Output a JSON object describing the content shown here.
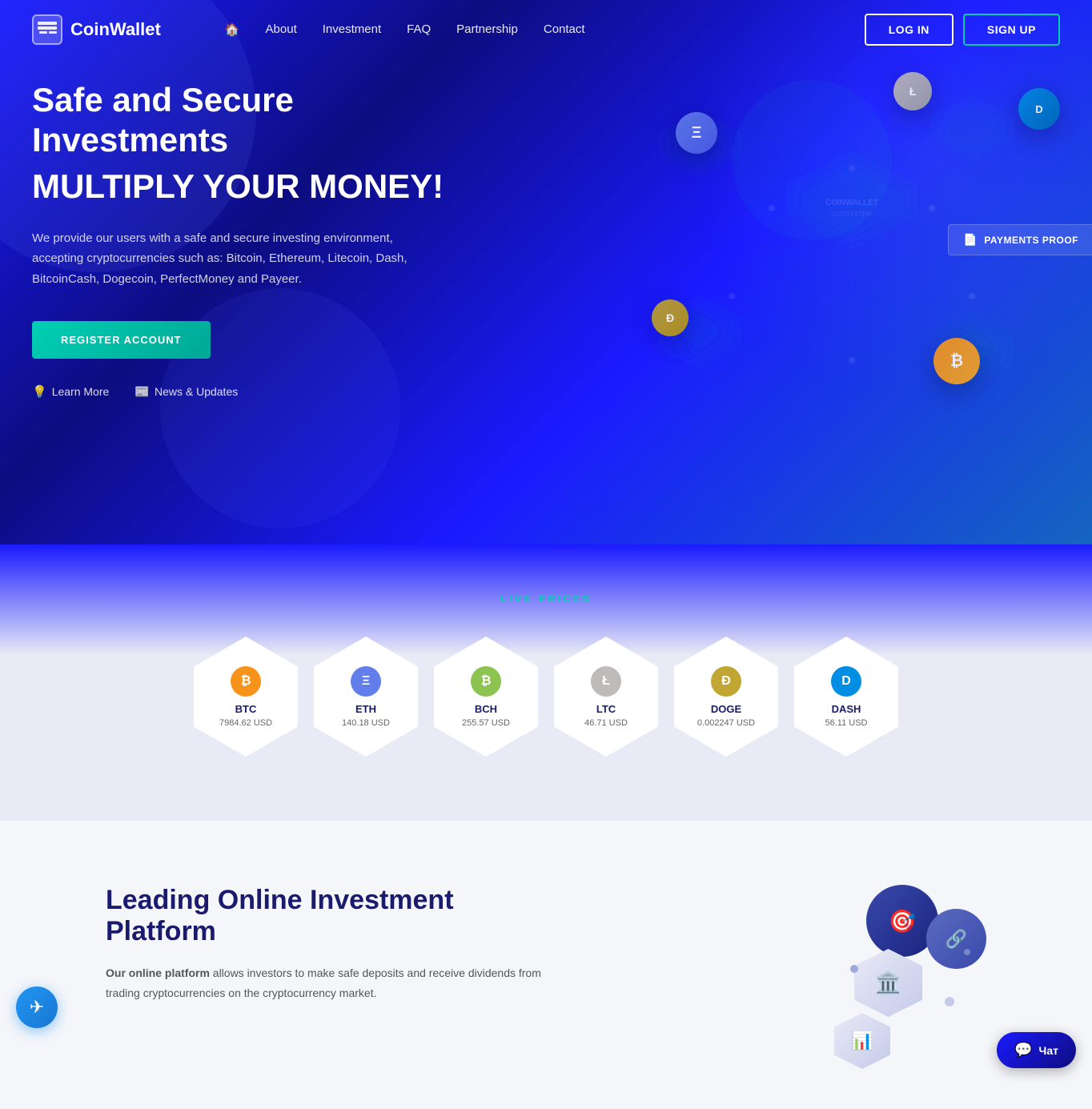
{
  "brand": {
    "name": "CoinWallet",
    "logo_icon": "💳"
  },
  "nav": {
    "home_icon": "🏠",
    "links": [
      {
        "label": "About",
        "href": "#about"
      },
      {
        "label": "Investment",
        "href": "#investment"
      },
      {
        "label": "FAQ",
        "href": "#faq"
      },
      {
        "label": "Partnership",
        "href": "#partnership"
      },
      {
        "label": "Contact",
        "href": "#contact"
      }
    ],
    "login_label": "LOG IN",
    "signup_label": "SIGN UP"
  },
  "hero": {
    "title_line1": "Safe and Secure Investments",
    "title_line2": "MULTIPLY YOUR MONEY!",
    "description": "We provide our users with a safe and secure investing environment, accepting cryptocurrencies such as: Bitcoin, Ethereum, Litecoin, Dash, BitcoinCash, Dogecoin, PerfectMoney and Payeer.",
    "register_btn": "REGISTER ACCOUNT",
    "learn_more_label": "Learn More",
    "news_updates_label": "News & Updates",
    "payments_proof_label": "PAYMENTS PROOF"
  },
  "live_prices": {
    "section_label": "LIVE PRICES",
    "coins": [
      {
        "symbol": "BTC",
        "price": "7984.62 USD",
        "icon_char": "₿",
        "color": "#f7931a"
      },
      {
        "symbol": "ETH",
        "price": "140.18 USD",
        "icon_char": "Ξ",
        "color": "#627eea"
      },
      {
        "symbol": "BCH",
        "price": "255.57 USD",
        "icon_char": "₿",
        "color": "#8dc351"
      },
      {
        "symbol": "LTC",
        "price": "46.71 USD",
        "icon_char": "Ł",
        "color": "#bfbbbb"
      },
      {
        "symbol": "DOGE",
        "price": "0.002247 USD",
        "icon_char": "Ð",
        "color": "#c2a633"
      },
      {
        "symbol": "DASH",
        "price": "56.11 USD",
        "icon_char": "D",
        "color": "#008de4"
      }
    ]
  },
  "about": {
    "title": "Leading Online Investment Platform",
    "description_bold": "Our online platform",
    "description": " allows investors to make safe deposits and receive dividends from trading cryptocurrencies on the cryptocurrency market."
  },
  "chat": {
    "telegram_title": "Telegram",
    "chat_label": "Чат"
  },
  "colors": {
    "primary": "#1a1aff",
    "primary_dark": "#0d0d80",
    "accent": "#00cfb4",
    "white": "#ffffff"
  }
}
